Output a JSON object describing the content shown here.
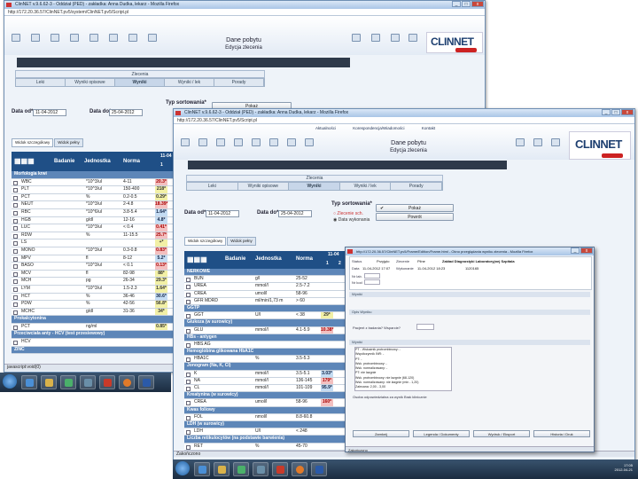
{
  "win1": {
    "title": "ClinNET v.9.6.62-3 - Oddział (PED) - zakładka: Anna Dudka, lekarz - Mozilla Firefox",
    "url": "http://172.20.36.57/ClinNET.pv5/system/ClinNET.pv5/Script.pl",
    "heading": "Dane pobytu",
    "subheading": "Edycja zlecenia",
    "toolbar_labels": [
      "F1",
      "F2",
      "F3",
      "F4",
      "F5",
      "F6",
      "F7",
      "F8"
    ],
    "band_title": "Zlecenia",
    "tabs": [
      "Leki",
      "Wyniki opisowe",
      "Wyniki",
      "Wyniki / lek",
      "Porady"
    ],
    "date_from_label": "Data od*",
    "date_from": "11-04-2012",
    "date_to_label": "Data do*",
    "date_to": "25-04-2012",
    "sort_label": "Typ sortowania*",
    "btn_show": "Pokaż",
    "sub_tabs": [
      "Widok szczegółowy",
      "Widok pełny"
    ],
    "grid_headers": [
      "Badanie",
      "Jednostka",
      "Norma"
    ],
    "grid_date": "11-04",
    "grid_cols": [
      "1",
      "2"
    ],
    "rows": [
      {
        "name": "Morfologia krwi",
        "cat": true
      },
      {
        "name": "WBC",
        "unit": "*10^3/ul",
        "norm": "4-11",
        "v1": "20.3*",
        "c1": "red"
      },
      {
        "name": "PLT",
        "unit": "*10^3/ul",
        "norm": "150-400",
        "v1": "218*",
        "c1": "yel"
      },
      {
        "name": "PCT",
        "unit": "%",
        "norm": "0.2-0.5",
        "v1": "0.29*",
        "c1": "yel"
      },
      {
        "name": "NEUT",
        "unit": "*10^3/ul",
        "norm": "2-4.8",
        "v1": "18.39*",
        "c1": "red"
      },
      {
        "name": "RBC",
        "unit": "*10^6/ul",
        "norm": "3.8-5.4",
        "v1": "1.64*",
        "c1": "blu"
      },
      {
        "name": "HGB",
        "unit": "g/dl",
        "norm": "12-16",
        "v1": "4.8*",
        "c1": "blu"
      },
      {
        "name": "LUC",
        "unit": "*10^3/ul",
        "norm": "< 0.4",
        "v1": "0.41*",
        "c1": "red"
      },
      {
        "name": "RDW",
        "unit": "%",
        "norm": "11-15.5",
        "v1": "25.7*",
        "c1": "red"
      },
      {
        "name": "LS",
        "unit": "",
        "norm": "",
        "v1": "+*",
        "c1": "yel"
      },
      {
        "name": "MONO",
        "unit": "*10^3/ul",
        "norm": "0.3-0.8",
        "v1": "0.83*",
        "c1": "red"
      },
      {
        "name": "MPV",
        "unit": "fl",
        "norm": "8-12",
        "v1": "5.2*",
        "c1": "blu"
      },
      {
        "name": "BASO",
        "unit": "*10^3/ul",
        "norm": "< 0.1",
        "v1": "0.13*",
        "c1": "red"
      },
      {
        "name": "MCV",
        "unit": "fl",
        "norm": "82-98",
        "v1": "88*",
        "c1": "yel"
      },
      {
        "name": "MCH",
        "unit": "pg",
        "norm": "26-34",
        "v1": "29.3*",
        "c1": "yel"
      },
      {
        "name": "LYM",
        "unit": "*10^3/ul",
        "norm": "1.5-2.3",
        "v1": "1.64*",
        "c1": "yel"
      },
      {
        "name": "HCT",
        "unit": "%",
        "norm": "36-46",
        "v1": "30.6*",
        "c1": "blu"
      },
      {
        "name": "PDW",
        "unit": "%",
        "norm": "42-56",
        "v1": "56.8*",
        "c1": "yel"
      },
      {
        "name": "MCHC",
        "unit": "g/dl",
        "norm": "31-36",
        "v1": "34*",
        "c1": "yel"
      },
      {
        "name": "Prokalcytonina",
        "cat": true
      },
      {
        "name": "PCT",
        "unit": "ng/ml",
        "norm": "",
        "v1": "0.85*",
        "c1": "yel"
      },
      {
        "name": "Przeciwciała anty - HCV (test przesiewowy)",
        "cat": true
      },
      {
        "name": "HCV",
        "unit": "",
        "norm": "",
        "v1": "",
        "c1": ""
      },
      {
        "name": "ZINC",
        "cat": true
      }
    ],
    "status": "javascript:void(0)"
  },
  "win2": {
    "title": "ClinNET v.9.6.62-3 - Oddział (PED) - zakładka: Anna Dudka, lekarz - Mozilla Firefox",
    "url": "http://172.20.36.57/ClinNET.pv5/Script.pl",
    "heading": "Dane pobytu",
    "subheading": "Edycja zlecenia",
    "menu": [
      "Aktualności",
      "Korespondencja/Wiadomości",
      "Kontakt"
    ],
    "band_title": "Zlecenia",
    "tabs": [
      "Leki",
      "Wyniki opisowe",
      "Wyniki",
      "Wyniki / lek",
      "Porady"
    ],
    "date_from_label": "Data od*",
    "date_from": "11-04-2012",
    "date_to_label": "Data do*",
    "date_to": "25-04-2012",
    "sort_label": "Typ sortowania*",
    "sort_opts": [
      "Zlecenie sch.",
      "Data wykonania"
    ],
    "btn_show": "Pokaż",
    "btn_back": "Powrót",
    "sub_tabs": [
      "Widok szczegółowy",
      "Widok pełny"
    ],
    "grid_headers": [
      "Badanie",
      "Jednostka",
      "Norma"
    ],
    "grid_date": "11-04",
    "grid_cols": [
      "1",
      "2"
    ],
    "rows": [
      {
        "name": "NERKOWE",
        "cat": true
      },
      {
        "name": "BUN",
        "unit": "g/l",
        "norm": "25-52",
        "v1": "",
        "c1": ""
      },
      {
        "name": "UREA",
        "unit": "mmol/l",
        "norm": "2.5-7.2",
        "v1": "",
        "c1": ""
      },
      {
        "name": "CREA",
        "unit": "umol/l",
        "norm": "58-96",
        "v1": "",
        "c1": ""
      },
      {
        "name": "GFR MDRD",
        "unit": "ml/min/1,73 m",
        "norm": "> 60",
        "v1": "",
        "c1": ""
      },
      {
        "name": "GGTP",
        "cat": true
      },
      {
        "name": "GGT",
        "unit": "U/l",
        "norm": "< 38",
        "v1": "29*",
        "c1": "yel"
      },
      {
        "name": "Glukoza (w surowicy)",
        "cat": true
      },
      {
        "name": "GLU",
        "unit": "mmol/l",
        "norm": "4.1-5.9",
        "v1": "10.38*",
        "c1": "red"
      },
      {
        "name": "HBs - antygen",
        "cat": true
      },
      {
        "name": "HBS AG",
        "unit": "",
        "norm": "",
        "v1": "",
        "c1": ""
      },
      {
        "name": "Hemoglobina glikowana HbA1C",
        "cat": true
      },
      {
        "name": "HBA1C",
        "unit": "%",
        "norm": "3.5-5.3",
        "v1": "",
        "c1": ""
      },
      {
        "name": "Jonogram (Na, K, Cl)",
        "cat": true
      },
      {
        "name": "K",
        "unit": "mmol/l",
        "norm": "3.5-5.1",
        "v1": "3.03*",
        "c1": "blu"
      },
      {
        "name": "NA",
        "unit": "mmol/l",
        "norm": "136-145",
        "v1": "179*",
        "c1": "red"
      },
      {
        "name": "CL",
        "unit": "mmol/l",
        "norm": "101-109",
        "v1": "95.9*",
        "c1": "blu"
      },
      {
        "name": "Kreatynina (w surowicy)",
        "cat": true
      },
      {
        "name": "CREA",
        "unit": "umol/l",
        "norm": "58-96",
        "v1": "160*",
        "c1": "red"
      },
      {
        "name": "Kwas foliowy",
        "cat": true
      },
      {
        "name": "FOL",
        "unit": "nmol/l",
        "norm": "8.8-60.8",
        "v1": "",
        "c1": ""
      },
      {
        "name": "LDH (w surowicy)",
        "cat": true
      },
      {
        "name": "LDH",
        "unit": "U/l",
        "norm": "< 248",
        "v1": "",
        "c1": ""
      },
      {
        "name": "Liczba retikulocytów (na podstawie barwienia)",
        "cat": true
      },
      {
        "name": "RET",
        "unit": "%",
        "norm": "45-70",
        "v1": "",
        "c1": ""
      }
    ],
    "status": "Zakończono"
  },
  "popup": {
    "title": "http://172.20.36.57/ClinNET.pv5/Frame/Edition/Frame.html - Okno przeglądania wyniku zlecenia - Mozilla Firefox",
    "fields": [
      {
        "label": "Status",
        "value": "Przyjęto"
      },
      {
        "label": "Zlecenie",
        "value": "Pilne"
      },
      {
        "label": "Data",
        "value": "11-04-2012 17:07"
      },
      {
        "label": "Wykonanie",
        "value": "11-04-2012 18:23"
      },
      {
        "label": "Nr lab.",
        "value": "1120165"
      },
      {
        "label": "Nr kod",
        "value": ""
      }
    ],
    "lab": "Zakład Diagnostyki Laboratoryjnej Szpitala",
    "sec1": "Wyniki",
    "sec2": "Opis Wyniku",
    "question": "Pacjent z badania? Wsparcie?",
    "sec3": "Wyniki",
    "list_items": [
      "PT - Wskaźnik protrombinowy: -",
      "Współczynnik INR: -",
      "PT: -",
      "Wsk. protrombinowy: -",
      "Wsk. normalizowany: -",
      "PT: nie lazgnie",
      "Wsk. protrombinowy: nie lazgnie (68-120)",
      "Wsk. normalizowany: nie lazgnie (min - 1,20)",
      "Zalecana: 2,00 - 3,00"
    ],
    "note": "Osoba odpowiedzialna za wynik Brak klinicznie",
    "buttons": [
      "Zamknij",
      "Legenda / Dokumenty",
      "Wydruk / Eksport",
      "Historia / Druk"
    ],
    "status": "Zakończono"
  },
  "taskbar1": {
    "time": "17:05",
    "date": "2012-04-21"
  },
  "taskbar2": {
    "time": "17:05",
    "date": "2012-04-21"
  }
}
